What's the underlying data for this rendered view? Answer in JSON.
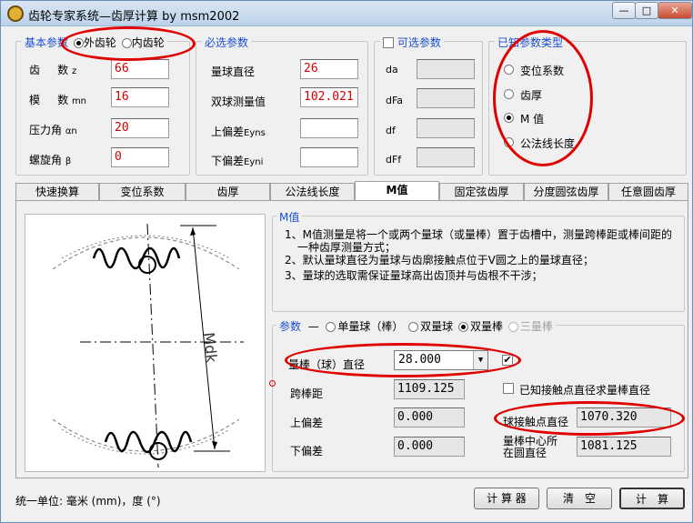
{
  "window": {
    "title": "齿轮专家系统—齿厚计算 by msm2002",
    "minimize": "—",
    "maximize": "□",
    "close": "✕"
  },
  "basic": {
    "legend": "基本参数",
    "gear_type_options": [
      "外齿轮",
      "内齿轮"
    ],
    "selected_gear_type": "外齿轮",
    "fields": [
      {
        "label": "齿",
        "label2": "数",
        "sub": "z",
        "value": "66"
      },
      {
        "label": "模",
        "label2": "数",
        "sub": "mn",
        "value": "16"
      },
      {
        "label": "压力角",
        "label2": "",
        "sub": "αn",
        "value": "20"
      },
      {
        "label": "螺旋角",
        "label2": "",
        "sub": "β",
        "value": "0"
      }
    ]
  },
  "required": {
    "legend": "必选参数",
    "fields": [
      {
        "label": "量球直径",
        "value": "26"
      },
      {
        "label": "双球测量值",
        "value": "102.021"
      },
      {
        "label": "上偏差",
        "sub": "Eyns",
        "value": ""
      },
      {
        "label": "下偏差",
        "sub": "Eyni",
        "value": ""
      }
    ]
  },
  "optional": {
    "legend": "可选参数",
    "fields": [
      {
        "label": "da",
        "value": ""
      },
      {
        "label": "dFa",
        "value": ""
      },
      {
        "label": "df",
        "value": ""
      },
      {
        "label": "dFf",
        "value": ""
      }
    ]
  },
  "known": {
    "legend": "已知参数类型",
    "options": [
      "变位系数",
      "齿厚",
      "M 值",
      "公法线长度"
    ],
    "selected": "M 值"
  },
  "tabs": [
    "快速换算",
    "变位系数",
    "齿厚",
    "公法线长度",
    "M值",
    "固定弦齿厚",
    "分度圆弦齿厚",
    "任意圆齿厚"
  ],
  "active_tab": "M值",
  "mvalue": {
    "info_legend": "M值",
    "notes": [
      "1、M值测量是将一个或两个量球（或量棒）置于齿槽中，测量跨棒距或棒间距的",
      "一种齿厚测量方式；",
      "2、默认量球直径为量球与齿廓接触点位于V圆之上的量球直径；",
      "3、量球的选取需保证量球高出齿顶并与齿根不干涉；"
    ],
    "diagram_label": "Mdk",
    "params_legend": "参数",
    "modes": [
      "单量球（棒）",
      "双量球",
      "双量棒",
      "三量棒"
    ],
    "selected_mode": "双量棒",
    "rod_diameter_label": "量棒（球）直径",
    "rod_diameter_value": "28.000",
    "rod_checkbox_checked": "✔",
    "cross_distance_label": "跨棒距",
    "cross_distance_value": "1109.125",
    "known_contact_label": "已知接触点直径求量棒直径",
    "upper_dev_label": "上偏差",
    "upper_dev_value": "0.000",
    "contact_diam_label": "球接触点直径",
    "contact_diam_value": "1070.320",
    "lower_dev_label": "下偏差",
    "lower_dev_value": "0.000",
    "center_circle_label": "量棒中心所在圆直径",
    "center_circle_value": "1081.125"
  },
  "footer": {
    "units": "统一单位:  毫米 (mm)，度 (°)",
    "calculator": "计 算 器",
    "clear": "清　空",
    "compute": "计　算"
  }
}
